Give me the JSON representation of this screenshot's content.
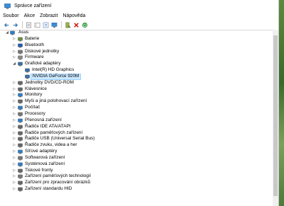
{
  "window": {
    "title": "Správce zařízení"
  },
  "menu": [
    "Soubor",
    "Akce",
    "Zobrazit",
    "Nápověda"
  ],
  "toolbar_icons": [
    "back-icon",
    "forward-icon",
    "properties-icon",
    "help-icon",
    "driver-icon",
    "monitor-icon",
    "scan-icon",
    "disable-icon",
    "uninstall-icon",
    "enable-icon"
  ],
  "tree": {
    "root": "Asus",
    "items": [
      {
        "label": "Baterie",
        "icon": "battery-icon",
        "color": "#6a8f3a"
      },
      {
        "label": "Bluetooth",
        "icon": "bluetooth-icon",
        "color": "#1e5bb8"
      },
      {
        "label": "Diskové jednotky",
        "icon": "disk-icon",
        "color": "#777777"
      },
      {
        "label": "Firmware",
        "icon": "firmware-icon",
        "color": "#8a8a8a"
      },
      {
        "label": "Grafické adaptéry",
        "icon": "display-adapter-icon",
        "color": "#3a6fa8",
        "expanded": true,
        "children": [
          {
            "label": "Intel(R) HD Graphics",
            "icon": "display-adapter-icon"
          },
          {
            "label": "NVIDIA GeForce 920M",
            "icon": "display-adapter-icon",
            "selected": true
          }
        ]
      },
      {
        "label": "Jednotky DVD/CD-ROM",
        "icon": "dvd-icon",
        "color": "#666666"
      },
      {
        "label": "Klávesnice",
        "icon": "keyboard-icon",
        "color": "#666666"
      },
      {
        "label": "Monitory",
        "icon": "monitor-icon",
        "color": "#2f7fc8"
      },
      {
        "label": "Myši a jiná polohovací zařízení",
        "icon": "mouse-icon",
        "color": "#666666"
      },
      {
        "label": "Počítač",
        "icon": "computer-icon",
        "color": "#2f7fc8"
      },
      {
        "label": "Procesory",
        "icon": "processor-icon",
        "color": "#777777"
      },
      {
        "label": "Přenosná zařízení",
        "icon": "portable-device-icon",
        "color": "#2f7fc8"
      },
      {
        "label": "Řadiče IDE ATA/ATAPI",
        "icon": "ide-controller-icon",
        "color": "#666666"
      },
      {
        "label": "Řadiče paměťových zařízení",
        "icon": "storage-controller-icon",
        "color": "#666666"
      },
      {
        "label": "Řadiče USB (Universal Serial Bus)",
        "icon": "usb-icon",
        "color": "#666666"
      },
      {
        "label": "Řadiče zvuku, videa a her",
        "icon": "sound-icon",
        "color": "#666666"
      },
      {
        "label": "Síťové adaptéry",
        "icon": "network-icon",
        "color": "#2f7fc8"
      },
      {
        "label": "Softwarová zařízení",
        "icon": "software-device-icon",
        "color": "#777777"
      },
      {
        "label": "Systémová zařízení",
        "icon": "system-device-icon",
        "color": "#2f7fc8"
      },
      {
        "label": "Tiskové fronty",
        "icon": "printer-icon",
        "color": "#666666"
      },
      {
        "label": "Zařízení paměťových technologií",
        "icon": "memory-tech-icon",
        "color": "#777777"
      },
      {
        "label": "Zařízení pro zpracování obrázků",
        "icon": "imaging-icon",
        "color": "#666666"
      },
      {
        "label": "Zařízení standardu HID",
        "icon": "hid-icon",
        "color": "#666666"
      }
    ]
  }
}
